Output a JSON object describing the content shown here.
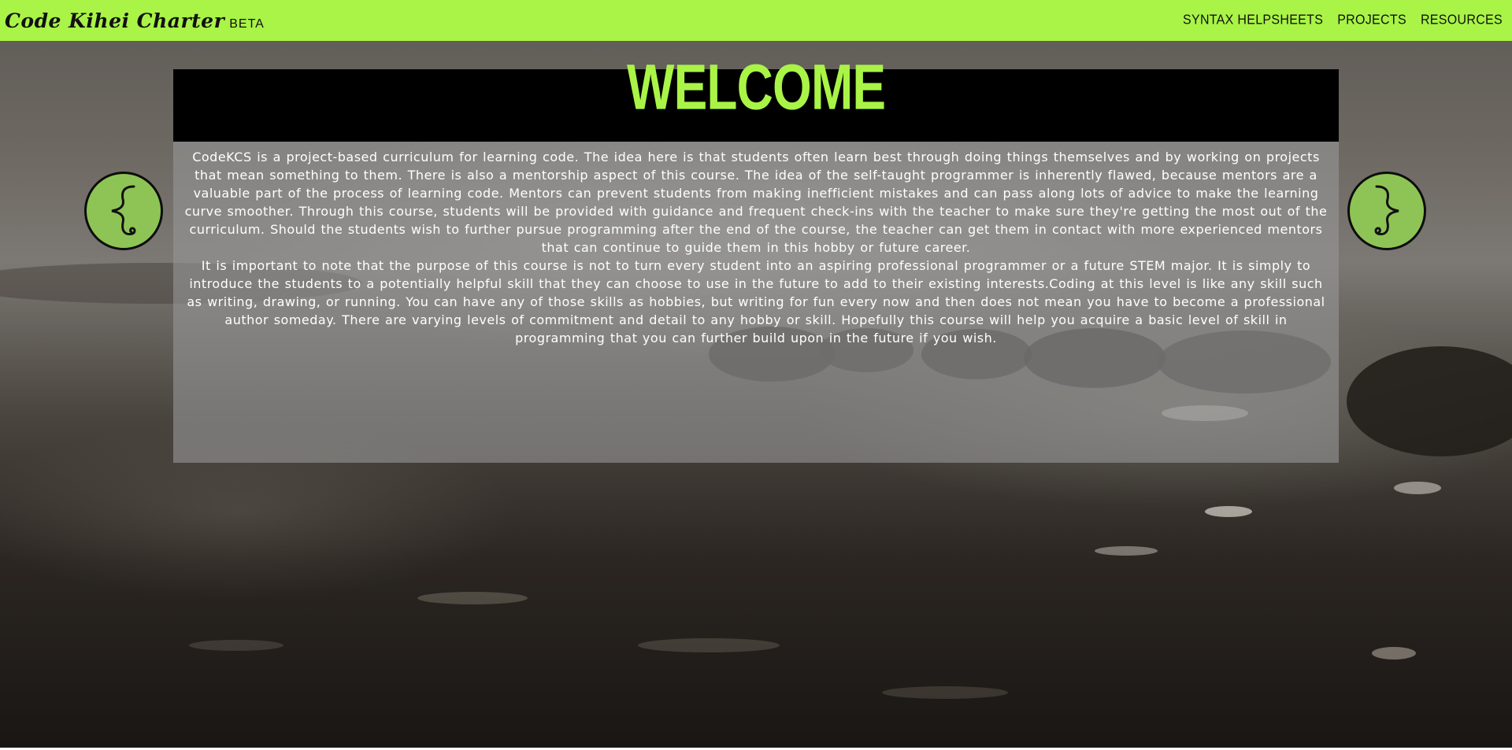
{
  "header": {
    "brand_name": "Code Kihei Charter",
    "brand_tag": "BETA",
    "accent_color": "#a9f446",
    "nav": [
      {
        "label": "SYNTAX HELPSHEETS"
      },
      {
        "label": "PROJECTS"
      },
      {
        "label": "RESOURCES"
      }
    ]
  },
  "main": {
    "title": "WELCOME",
    "paragraphs": [
      "CodeKCS is a project-based curriculum for learning code. The idea here is that students often learn best through doing things themselves and by working on projects that mean something to them. There is also a mentorship aspect of this course. The idea of the self-taught programmer is inherently flawed, because mentors are a valuable part of the process of learning code. Mentors can prevent students from making inefficient mistakes and can pass along lots of advice to make the learning curve smoother. Through this course, students will be provided with guidance and frequent check-ins with the teacher to make sure they're getting the most out of the curriculum. Should the students wish to further pursue programming after the end of the course, the teacher can get them in contact with more experienced mentors that can continue to guide them in this hobby or future career.",
      "It is important to note that the purpose of this course is not to turn every student into an aspiring professional programmer or a future STEM major. It is simply to introduce the students to a potentially helpful skill that they can choose to use in the future to add to their existing interests.Coding at this level is like any skill such as writing, drawing, or running. You can have any of those skills as hobbies, but writing for fun every now and then does not mean you have to become a professional author someday. There are varying levels of commitment and detail to any hobby or skill. Hopefully this course will help you acquire a basic level of skill in programming that you can further build upon in the future if you wish."
    ]
  },
  "controls": {
    "prev_icon": "left-curly-brace-icon",
    "next_icon": "right-curly-brace-icon",
    "button_color": "#8ec456"
  }
}
